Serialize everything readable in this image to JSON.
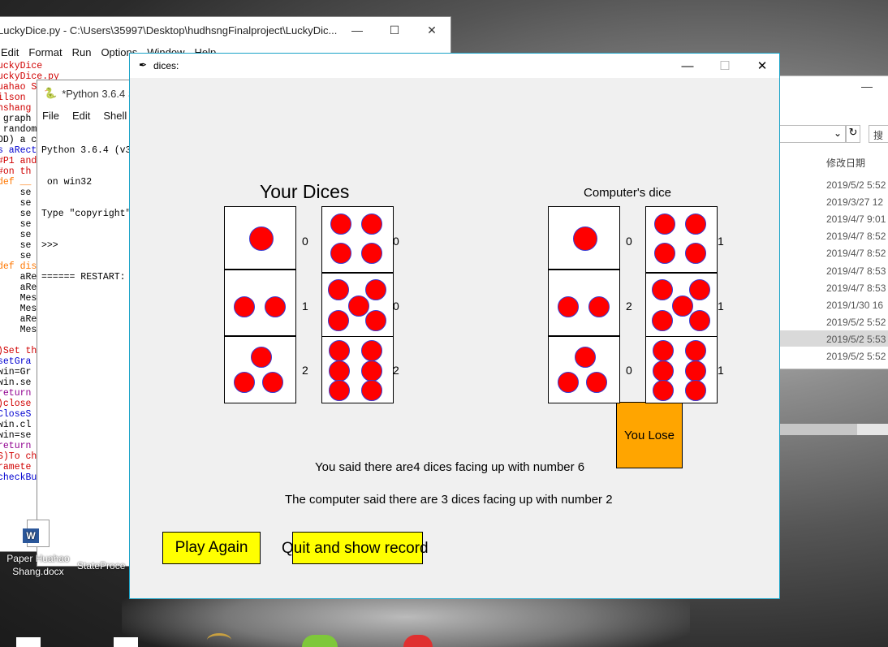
{
  "editor": {
    "title": "LuckyDice.py - C:\\Users\\35997\\Desktop\\hudhsngFinalproject\\LuckyDic...",
    "menu": [
      "Edit",
      "Format",
      "Run",
      "Options",
      "Window",
      "Help"
    ],
    "code_lines": [
      "uckyDice",
      "uckyDice.py",
      "uahao Sh",
      "ilson",
      "hshang",
      " graph",
      " random",
      "OD) a c",
      "s aRect",
      "#P1 and",
      "#on th",
      "def __",
      "    se",
      "    se",
      "    se",
      "    se",
      "    se",
      "    se",
      "    se",
      "def dis",
      "    aRe",
      "    aRe",
      "    Mes",
      "    Mes",
      "    aRe",
      "    Mes",
      "",
      ")Set th",
      "setGra",
      "win=Gr",
      "win.se",
      "return",
      ")close",
      "CloseS",
      "win.cl",
      "win=se",
      "return",
      "S)To ch",
      "ramete",
      "checkBu"
    ]
  },
  "shell": {
    "title": "*Python 3.6.4 S",
    "menu": [
      "File",
      "Edit",
      "Shell"
    ],
    "lines": [
      "Python 3.6.4 (v3",
      " on win32",
      "Type \"copyright\"",
      ">>>",
      "====== RESTART:"
    ]
  },
  "explorer": {
    "column_header": "修改日期",
    "search_label": "搜",
    "dates": [
      "2019/5/2 5:52",
      "2019/3/27 12",
      "2019/4/7 9:01",
      "2019/4/7 8:52",
      "2019/4/7 8:52",
      "2019/4/7 8:53",
      "2019/4/7 8:53",
      "2019/1/30 16",
      "2019/5/2 5:52",
      "2019/5/2 5:53",
      "2019/5/2 5:52"
    ]
  },
  "desktop_icons": [
    {
      "label": "Paper Huahao\nShang.docx"
    },
    {
      "label": "StateProce"
    }
  ],
  "dice_window": {
    "title": "dices:",
    "your_label": "Your Dices",
    "computer_label": "Computer's dice",
    "player_counts_left": [
      "0",
      "1",
      "2"
    ],
    "player_counts_right": [
      "0",
      "0",
      "2"
    ],
    "computer_counts_left": [
      "0",
      "2",
      "0"
    ],
    "computer_counts_right": [
      "1",
      "1",
      "1"
    ],
    "result": "You Lose",
    "your_statement": "You said there are4 dices facing up with number 6",
    "computer_statement": "The computer said there are 3 dices facing up with number 2",
    "play_again": "Play Again",
    "quit_label": "Quit and show record",
    "dice_faces": [
      1,
      2,
      3,
      4,
      5,
      6
    ],
    "pip_color": "#ff0000",
    "button_color": "#ffff00",
    "result_color": "#ffa500"
  }
}
